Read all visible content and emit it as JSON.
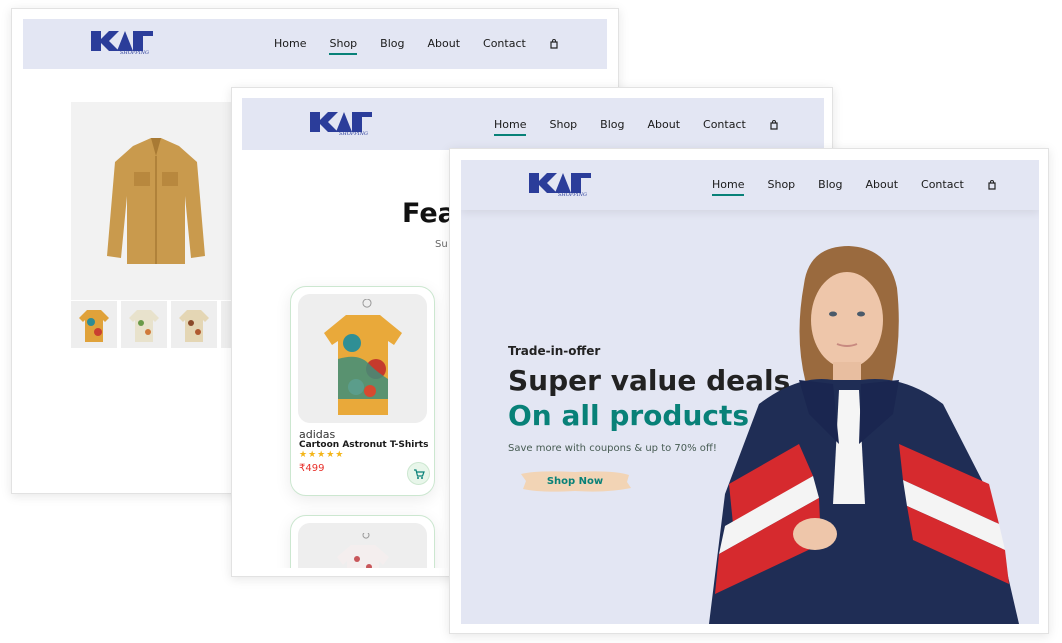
{
  "logo": {
    "text": "KART",
    "subtext": "SHOPPING"
  },
  "nav_links": [
    "Home",
    "Shop",
    "Blog",
    "About",
    "Contact"
  ],
  "shop_page": {
    "active_link": "Shop"
  },
  "featured_page": {
    "active_link": "Home",
    "title": "Fea",
    "subtitle": "Su",
    "products": [
      {
        "brand": "adidas",
        "name": "Cartoon Astronut T-Shirts",
        "rating": "★★★★★",
        "price": "₹499"
      }
    ]
  },
  "home_page": {
    "active_link": "Home",
    "hero": {
      "kicker": "Trade-in-offer",
      "headline_1": "Super value deals",
      "headline_2": "On all products",
      "tagline": "Save more with coupons & up to 70% off!",
      "button": "Shop Now"
    }
  },
  "colors": {
    "accent": "#088178",
    "nav_bg": "#e3e6f3",
    "price": "#e8302a",
    "star": "#f3b519",
    "button_bg": "#f2d4b5"
  },
  "icons": {
    "cart": "bag-icon",
    "add_to_cart": "shopping-cart-icon"
  }
}
